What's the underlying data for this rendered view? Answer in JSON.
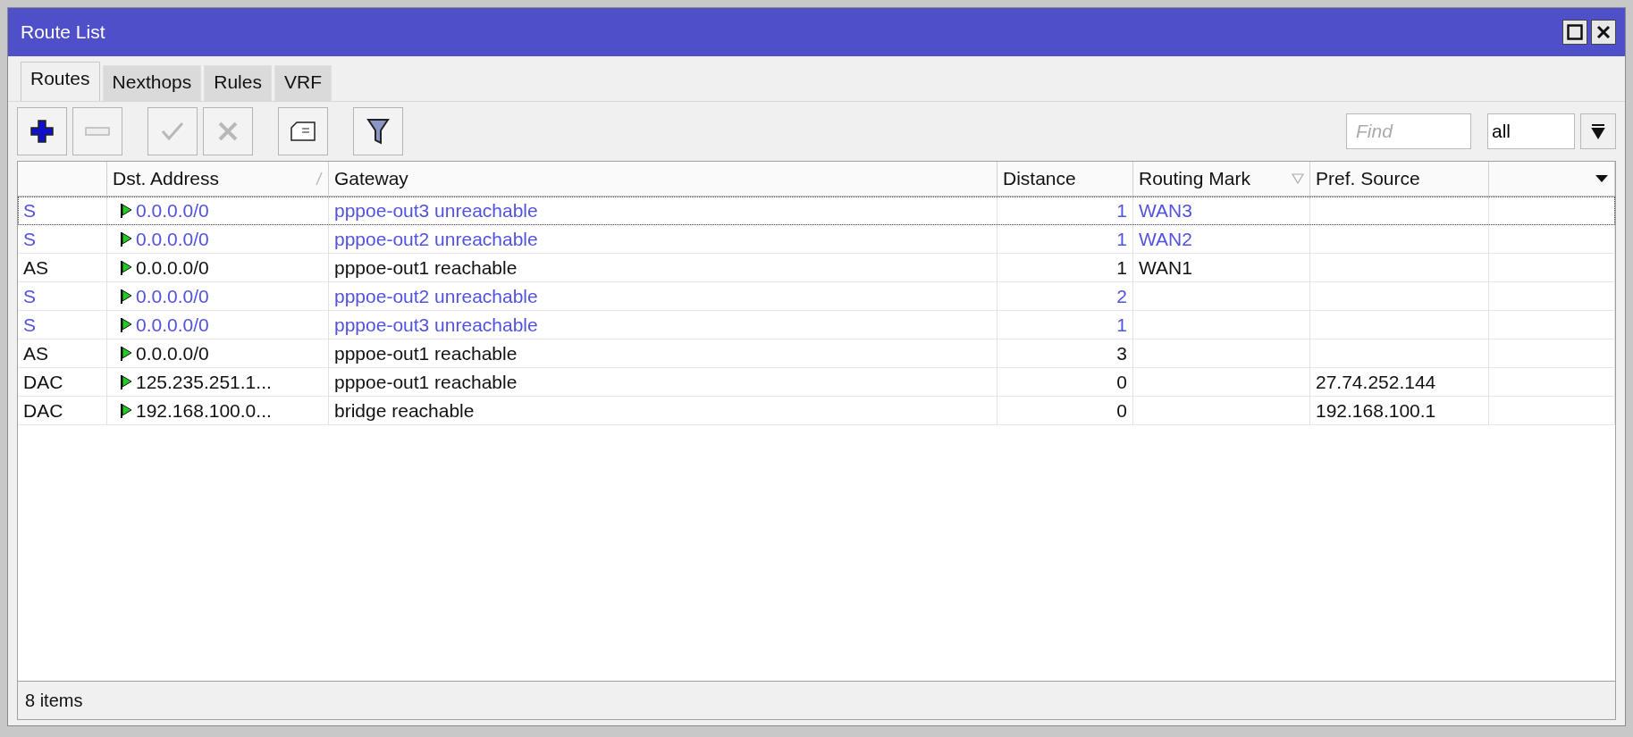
{
  "window": {
    "title": "Route List"
  },
  "tabs": [
    {
      "label": "Routes",
      "selected": true
    },
    {
      "label": "Nexthops",
      "selected": false
    },
    {
      "label": "Rules",
      "selected": false
    },
    {
      "label": "VRF",
      "selected": false
    }
  ],
  "toolbar": [
    {
      "kind": "add",
      "disabled": false
    },
    {
      "kind": "remove",
      "disabled": true
    },
    {
      "kind": "enable",
      "disabled": true
    },
    {
      "kind": "disable",
      "disabled": true
    },
    {
      "kind": "comment",
      "disabled": false
    },
    {
      "kind": "filter",
      "disabled": false
    }
  ],
  "search": {
    "placeholder": "Find"
  },
  "filter_select": {
    "value": "all"
  },
  "table": {
    "columns": [
      {
        "sorted": false,
        "filtered": false
      },
      {
        "label": "Dst. Address",
        "sorted": true,
        "filtered": false
      },
      {
        "label": "Gateway",
        "sorted": false,
        "filtered": false
      },
      {
        "label": "Distance",
        "sorted": false,
        "filtered": false
      },
      {
        "label": "Routing Mark",
        "sorted": false,
        "filtered": true
      },
      {
        "label": "Pref. Source",
        "sorted": false,
        "filtered": false
      },
      {
        "sorted": false,
        "filtered": false
      }
    ],
    "rows": [
      {
        "flags": "S",
        "dst": "0.0.0.0/0",
        "gateway": "pppoe-out3 unreachable",
        "distance": "1",
        "routing_mark": "WAN3",
        "pref_source": "",
        "active": false,
        "selected": true
      },
      {
        "flags": "S",
        "dst": "0.0.0.0/0",
        "gateway": "pppoe-out2 unreachable",
        "distance": "1",
        "routing_mark": "WAN2",
        "pref_source": "",
        "active": false,
        "selected": false
      },
      {
        "flags": "AS",
        "dst": "0.0.0.0/0",
        "gateway": "pppoe-out1 reachable",
        "distance": "1",
        "routing_mark": "WAN1",
        "pref_source": "",
        "active": true,
        "selected": false
      },
      {
        "flags": "S",
        "dst": "0.0.0.0/0",
        "gateway": "pppoe-out2 unreachable",
        "distance": "2",
        "routing_mark": "",
        "pref_source": "",
        "active": false,
        "selected": false
      },
      {
        "flags": "S",
        "dst": "0.0.0.0/0",
        "gateway": "pppoe-out3 unreachable",
        "distance": "1",
        "routing_mark": "",
        "pref_source": "",
        "active": false,
        "selected": false
      },
      {
        "flags": "AS",
        "dst": "0.0.0.0/0",
        "gateway": "pppoe-out1 reachable",
        "distance": "3",
        "routing_mark": "",
        "pref_source": "",
        "active": true,
        "selected": false
      },
      {
        "flags": "DAC",
        "dst": "125.235.251.1...",
        "gateway": "pppoe-out1 reachable",
        "distance": "0",
        "routing_mark": "",
        "pref_source": "27.74.252.144",
        "active": true,
        "selected": false
      },
      {
        "flags": "DAC",
        "dst": "192.168.100.0...",
        "gateway": "bridge reachable",
        "distance": "0",
        "routing_mark": "",
        "pref_source": "192.168.100.1",
        "active": true,
        "selected": false
      }
    ]
  },
  "status_bar": {
    "text": "8 items"
  }
}
